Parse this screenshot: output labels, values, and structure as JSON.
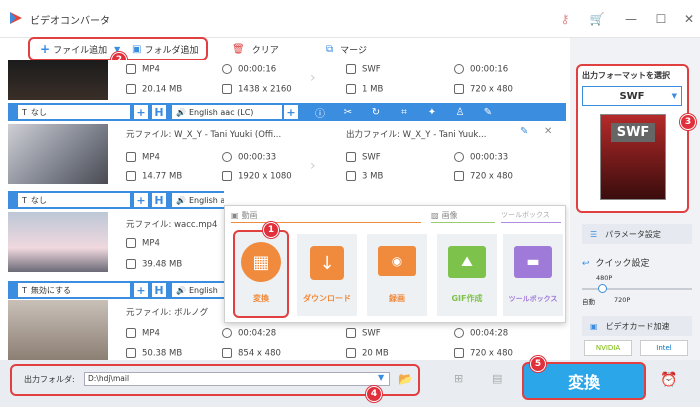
{
  "app": {
    "title": "ビデオコンバータ"
  },
  "toolbar": {
    "add_file": "ファイル追加",
    "add_folder": "フォルダ追加",
    "clear": "クリア",
    "merge": "マージ"
  },
  "badges": [
    "1",
    "2",
    "3",
    "4",
    "5"
  ],
  "items": [
    {
      "src_format": "MP4",
      "src_duration": "00:00:16",
      "src_size": "20.14 MB",
      "src_res": "1438 x 2160",
      "dst_format": "SWF",
      "dst_duration": "00:00:16",
      "dst_size": "1 MB",
      "dst_res": "720 x 480"
    },
    {
      "src_name": "元ファイル: W_X_Y - Tani Yuuki (Offi...",
      "dst_name": "出力ファイル: W_X_Y - Tani Yuuk...",
      "src_format": "MP4",
      "src_duration": "00:00:33",
      "src_size": "14.77 MB",
      "src_res": "1920 x 1080",
      "dst_format": "SWF",
      "dst_duration": "00:00:33",
      "dst_size": "3 MB",
      "dst_res": "720 x 480"
    },
    {
      "src_name": "元ファイル: wacc.mp4",
      "src_format": "MP4",
      "src_size": "39.48 MB"
    },
    {
      "src_name": "元ファイル: ボルノグ",
      "src_format": "MP4",
      "src_duration": "00:04:28",
      "src_size": "50.38 MB",
      "src_res": "854 x 480",
      "dst_format": "SWF",
      "dst_duration": "00:04:28",
      "dst_size": "20 MB",
      "dst_res": "720 x 480"
    }
  ],
  "edit_bars": [
    {
      "subtitle": "なし",
      "audio": "English aac (LC)"
    },
    {
      "subtitle": "なし",
      "audio": "English aac (LC)"
    },
    {
      "subtitle": "無効にする",
      "audio": "English"
    }
  ],
  "popup": {
    "tabs": [
      "動画",
      "画像",
      "ツールボックス"
    ],
    "tiles": [
      "変換",
      "ダウンロード",
      "録画",
      "GIF作成",
      "ツールボックス"
    ]
  },
  "right": {
    "format_header": "出力フォーマットを選択",
    "format_value": "SWF",
    "format_icon_text": "SWF",
    "param_settings": "パラメータ設定",
    "quick_settings": "クイック設定",
    "slider_top": "480P",
    "slider_left": "自動",
    "slider_bottom": "720P",
    "gpu_accel": "ビデオカード加速",
    "nvidia": "NVIDIA",
    "intel": "Intel"
  },
  "bottom": {
    "output_label": "出力フォルダ:",
    "output_path": "D:\\hdj\\mail",
    "convert": "変換"
  },
  "colors": {
    "accent": "#3b8de0",
    "convert_bg": "#2ba6e8",
    "highlight": "#e04040",
    "tile_orange": "#f08a3c"
  }
}
